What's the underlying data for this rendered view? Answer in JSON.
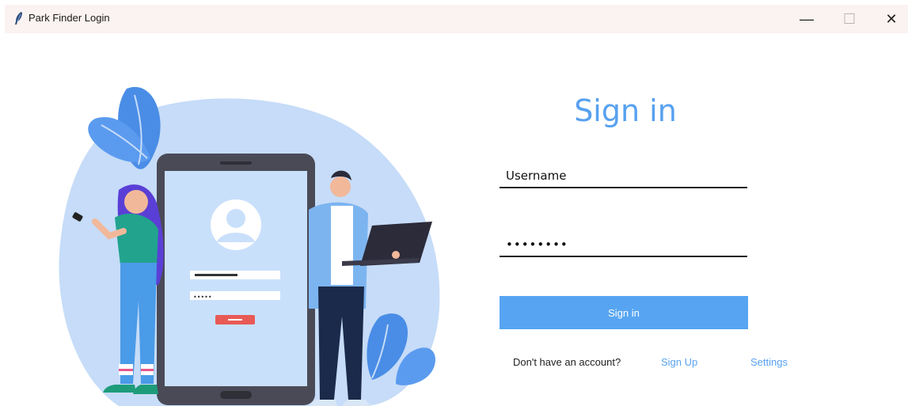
{
  "window": {
    "title": "Park Finder Login",
    "minimize_glyph": "—",
    "maximize_glyph": "☐",
    "close_glyph": "✕"
  },
  "illustration": {
    "phone_password_mask": "•••••"
  },
  "form": {
    "heading": "Sign in",
    "username_value": "Username",
    "password_value": "••••••••",
    "submit_label": "Sign in"
  },
  "footer": {
    "no_account_text": "Don't have an account?",
    "signup_link": "Sign Up",
    "settings_link": "Settings"
  },
  "colors": {
    "accent": "#57a5f2",
    "titlebar_bg": "#fbf3f1"
  }
}
